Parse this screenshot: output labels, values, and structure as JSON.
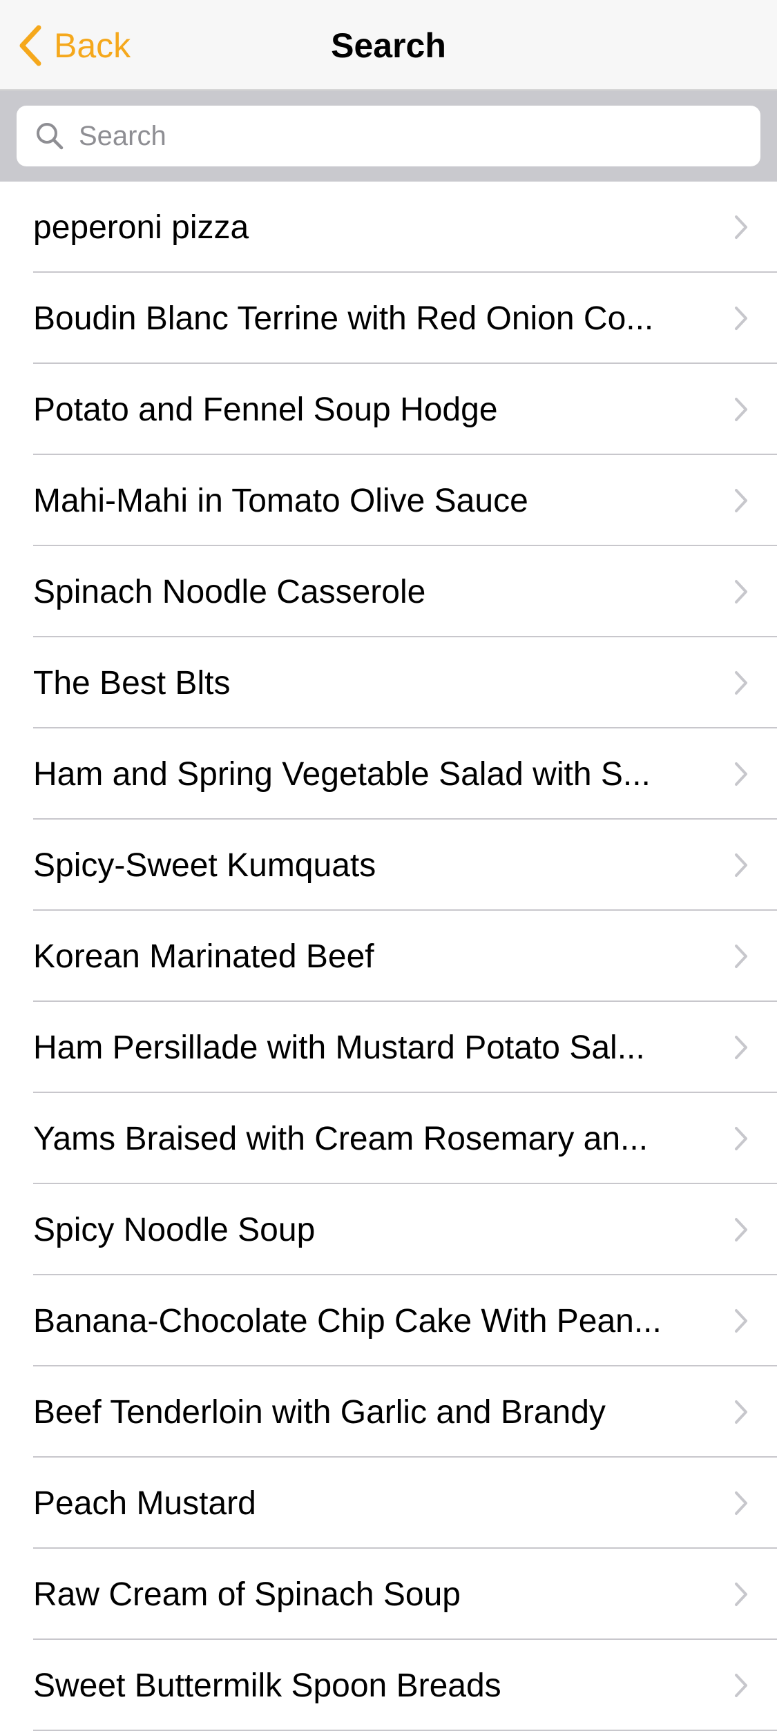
{
  "navbar": {
    "back_label": "Back",
    "title": "Search"
  },
  "search": {
    "placeholder": "Search",
    "value": ""
  },
  "list": {
    "items": [
      {
        "label": "peperoni pizza"
      },
      {
        "label": "Boudin Blanc Terrine with Red Onion Co..."
      },
      {
        "label": "Potato and Fennel Soup Hodge"
      },
      {
        "label": "Mahi-Mahi in Tomato Olive Sauce"
      },
      {
        "label": "Spinach Noodle Casserole"
      },
      {
        "label": "The Best Blts"
      },
      {
        "label": "Ham and Spring Vegetable Salad with S..."
      },
      {
        "label": "Spicy-Sweet Kumquats"
      },
      {
        "label": "Korean Marinated Beef"
      },
      {
        "label": "Ham Persillade with Mustard Potato Sal..."
      },
      {
        "label": "Yams Braised with Cream Rosemary an..."
      },
      {
        "label": "Spicy Noodle Soup"
      },
      {
        "label": "Banana-Chocolate Chip Cake With Pean..."
      },
      {
        "label": "Beef Tenderloin with Garlic and Brandy"
      },
      {
        "label": "Peach Mustard"
      },
      {
        "label": "Raw Cream of Spinach Soup"
      },
      {
        "label": "Sweet Buttermilk Spoon Breads"
      }
    ]
  },
  "colors": {
    "accent": "#f5a81c",
    "navbar_bg": "#f7f7f7",
    "searchbar_bg": "#c9c9ce",
    "separator": "#c8c7cc",
    "chevron": "#c7c7cc"
  },
  "icons": {
    "back": "chevron-left-icon",
    "search": "magnifier-icon",
    "disclosure": "chevron-right-icon"
  }
}
